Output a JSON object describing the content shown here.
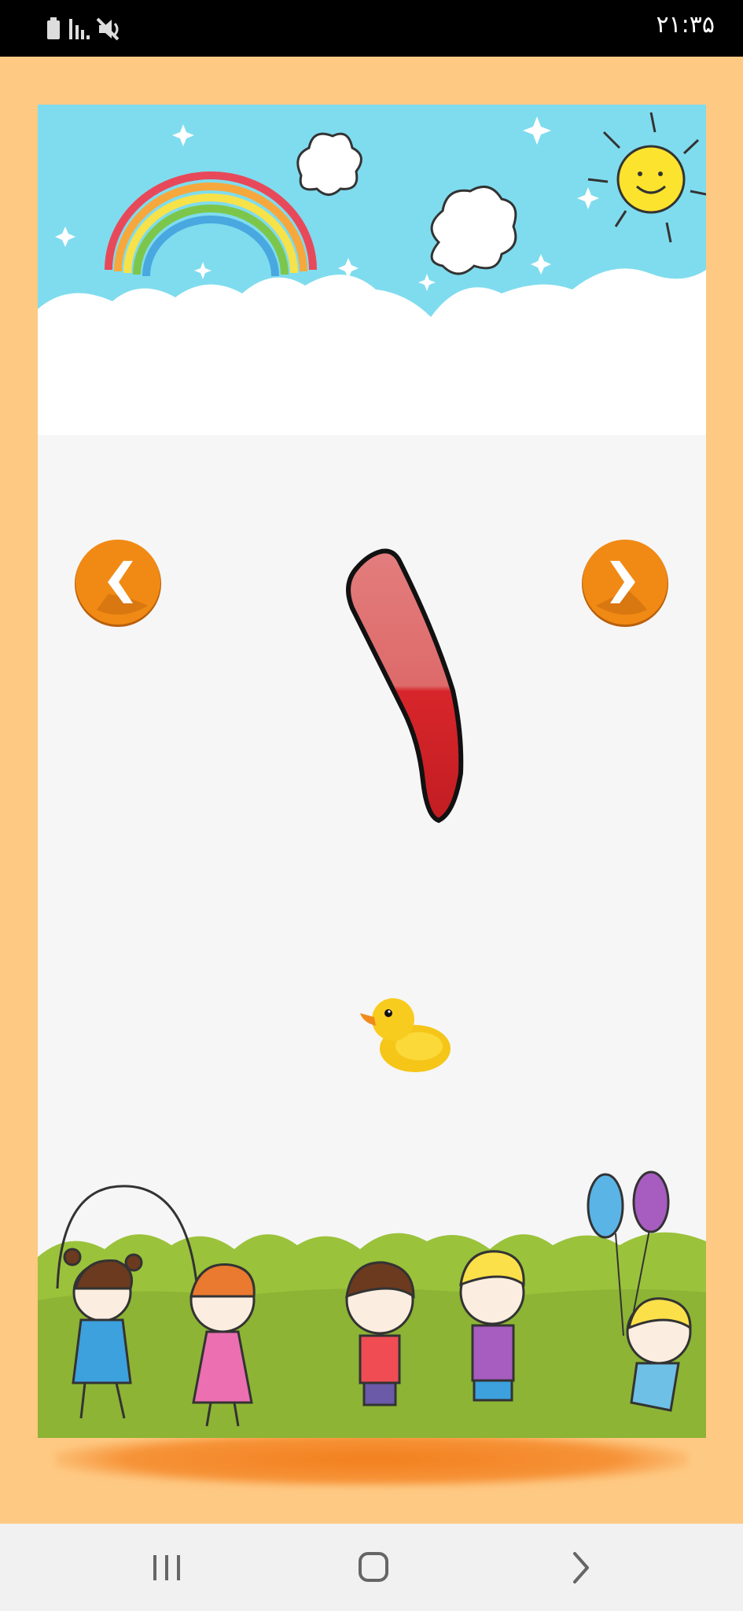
{
  "status_bar": {
    "time": "۲۱:۳۵",
    "icons": [
      "battery-icon",
      "signal-icon",
      "mute-icon"
    ]
  },
  "lesson": {
    "numeral": "۱",
    "picture": "duck-image",
    "count": 1
  },
  "controls": {
    "prev_icon": "chevron-left-icon",
    "next_icon": "chevron-right-icon"
  },
  "navigation_bar": {
    "keys": [
      "recents-icon",
      "home-icon",
      "back-icon"
    ]
  },
  "colors": {
    "page_background": "#fec983",
    "sky": "#7fdcee",
    "grass": "#9bc23b",
    "button_orange": "#f08a14",
    "numeral_red": "#d7262b"
  }
}
